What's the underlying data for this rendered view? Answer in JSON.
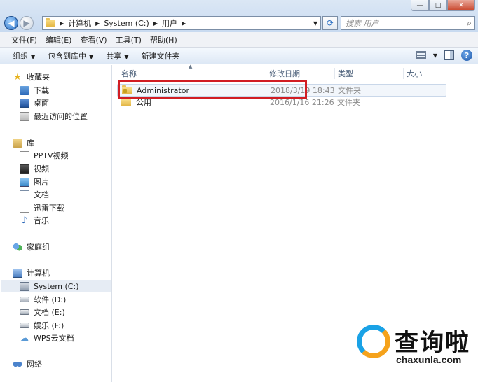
{
  "window": {
    "controls": {
      "minimize": "—",
      "maximize": "□",
      "close": "✕"
    }
  },
  "address_bar": {
    "crumbs": [
      "计算机",
      "System (C:)",
      "用户"
    ],
    "search_placeholder": "搜索 用户"
  },
  "menu": [
    "文件(F)",
    "编辑(E)",
    "查看(V)",
    "工具(T)",
    "帮助(H)"
  ],
  "commands": {
    "organize": "组织",
    "include_in_library": "包含到库中",
    "share": "共享",
    "new_folder": "新建文件夹"
  },
  "nav": {
    "favorites": "收藏夹",
    "downloads": "下载",
    "desktop": "桌面",
    "recent": "最近访问的位置",
    "libraries": "库",
    "pptv": "PPTV视频",
    "videos": "视频",
    "pictures": "图片",
    "documents": "文档",
    "xunlei": "迅雷下载",
    "music": "音乐",
    "homegroup": "家庭组",
    "computer": "计算机",
    "drive_c": "System (C:)",
    "drive_d": "软件 (D:)",
    "drive_e": "文档 (E:)",
    "drive_f": "娱乐 (F:)",
    "wps": "WPS云文档",
    "network": "网络"
  },
  "columns": {
    "name": "名称",
    "modified": "修改日期",
    "type": "类型",
    "size": "大小"
  },
  "files": [
    {
      "name": "Administrator",
      "modified": "2018/3/19 18:43",
      "type": "文件夹"
    },
    {
      "name": "公用",
      "modified": "2016/1/16 21:26",
      "type": "文件夹"
    }
  ],
  "watermark": {
    "title": "查询啦",
    "url": "chaxunla.com"
  },
  "colors": {
    "highlight_box": "#d11d23",
    "accent_blue": "#1aa2e6",
    "accent_orange": "#f5a21b"
  }
}
